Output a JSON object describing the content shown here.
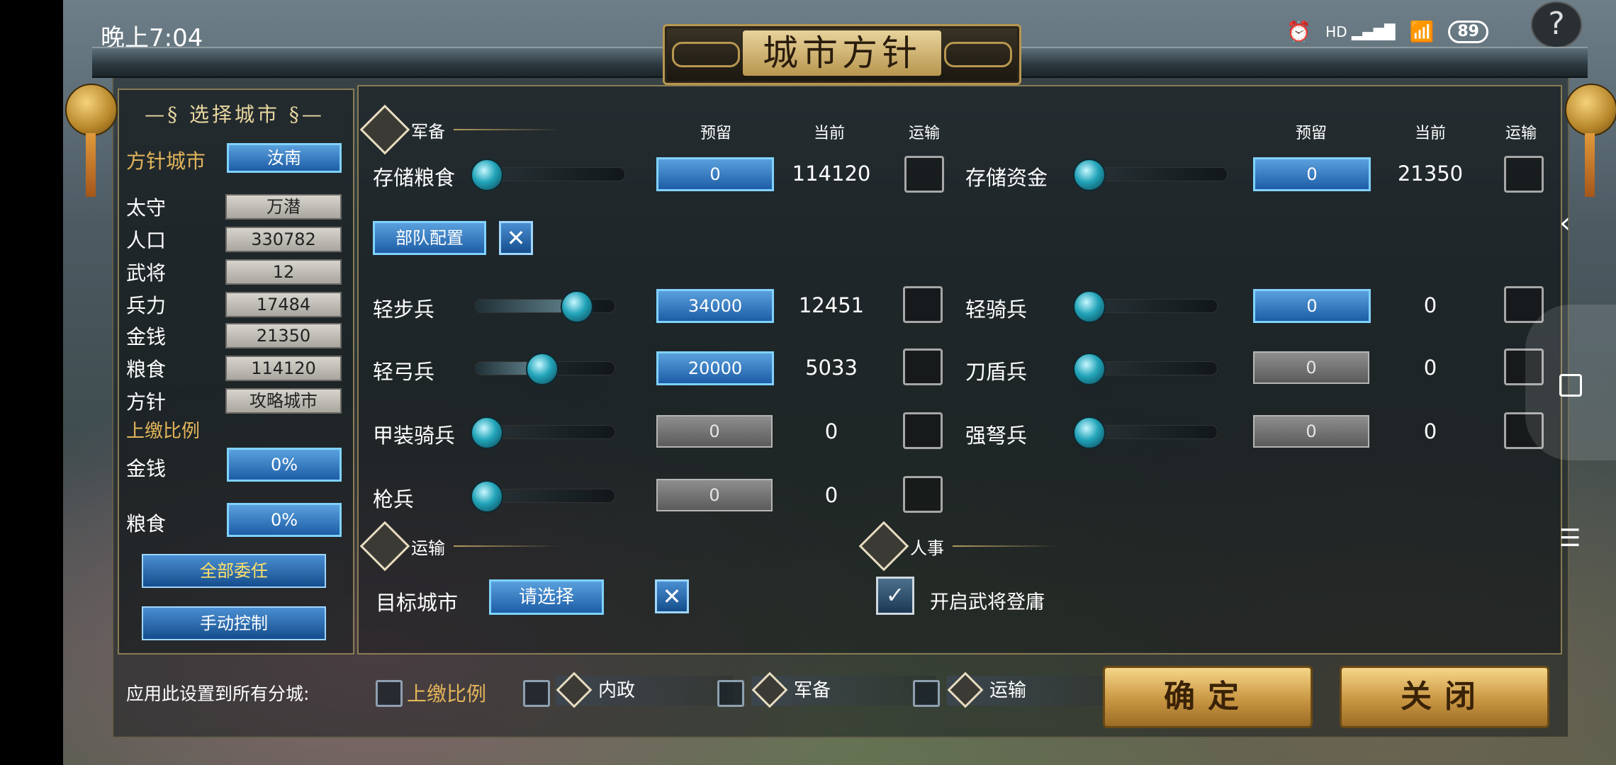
{
  "status_bar": {
    "time": "晚上7:04",
    "network": "HD",
    "battery": "89",
    "alarm_icon": "alarm-icon",
    "wifi_icon": "wifi-icon",
    "signal_icon": "signal-icon"
  },
  "help": "?",
  "title": "城市方针",
  "left": {
    "select_city": "选择城市",
    "policy_city_label": "方针城市",
    "policy_city_value": "汝南",
    "stats": [
      {
        "label": "太守",
        "value": "万潜"
      },
      {
        "label": "人口",
        "value": "330782"
      },
      {
        "label": "武将",
        "value": "12"
      },
      {
        "label": "兵力",
        "value": "17484"
      },
      {
        "label": "金钱",
        "value": "21350"
      },
      {
        "label": "粮食",
        "value": "114120"
      },
      {
        "label": "方针",
        "value": "攻略城市"
      }
    ],
    "tribute_label": "上缴比例",
    "tribute_money_label": "金钱",
    "tribute_money_value": "0%",
    "tribute_food_label": "粮食",
    "tribute_food_value": "0%",
    "delegate_all": "全部委任",
    "manual_control": "手动控制"
  },
  "military": {
    "header": "军备",
    "col_reserve": "预留",
    "col_current": "当前",
    "col_transport": "运输",
    "store_food": {
      "label": "存储粮食",
      "reserve": "0",
      "current": "114120"
    },
    "store_money": {
      "label": "存储资金",
      "reserve": "0",
      "current": "21350"
    },
    "troop_config": "部队配置",
    "troops_left": [
      {
        "label": "轻步兵",
        "reserve": "34000",
        "current": "12451",
        "level": 0.65,
        "active": true
      },
      {
        "label": "轻弓兵",
        "reserve": "20000",
        "current": "5033",
        "level": 0.4,
        "active": true
      },
      {
        "label": "甲装骑兵",
        "reserve": "0",
        "current": "0",
        "level": 0,
        "active": false
      },
      {
        "label": "枪兵",
        "reserve": "0",
        "current": "0",
        "level": 0,
        "active": false
      }
    ],
    "troops_right": [
      {
        "label": "轻骑兵",
        "reserve": "0",
        "current": "0",
        "level": 0,
        "active": true
      },
      {
        "label": "刀盾兵",
        "reserve": "0",
        "current": "0",
        "level": 0,
        "active": false
      },
      {
        "label": "强弩兵",
        "reserve": "0",
        "current": "0",
        "level": 0,
        "active": false
      }
    ]
  },
  "transport": {
    "header": "运输",
    "target_label": "目标城市",
    "target_value": "请选择"
  },
  "personnel": {
    "header": "人事",
    "enable_recruit": "开启武将登庸"
  },
  "bottom": {
    "apply_label": "应用此设置到所有分城:",
    "opt_tribute": "上缴比例",
    "opt_internal": "内政",
    "opt_military": "军备",
    "opt_transport": "运输",
    "confirm": "确定",
    "close": "关闭"
  },
  "x_mark": "✕",
  "check_mark": "✓"
}
